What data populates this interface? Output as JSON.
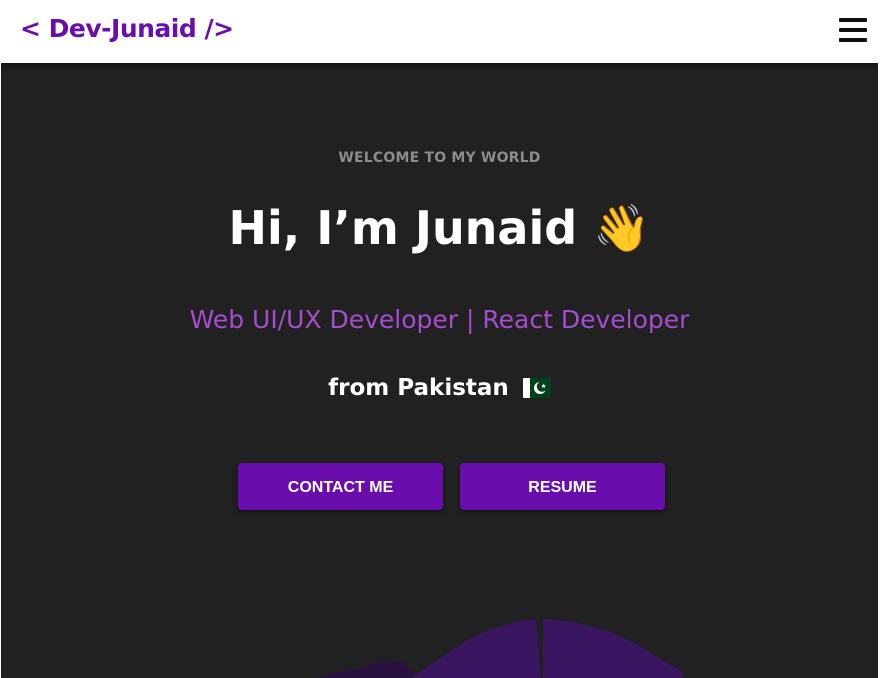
{
  "navbar": {
    "logo_text": "< Dev-Junaid />",
    "menu_icon": "hamburger-menu-icon"
  },
  "hero": {
    "welcome": "WELCOME TO MY WORLD",
    "greeting": "Hi, I’m Junaid",
    "greeting_emoji": "👋",
    "role": "Web UI/UX Developer | React Developer",
    "origin": "from Pakistan",
    "origin_flag_icon": "pakistan-flag-icon",
    "buttons": {
      "contact_label": "CONTACT ME",
      "resume_label": "RESUME"
    }
  },
  "colors": {
    "accent": "#6a0dad",
    "role_text": "#a64dcf",
    "background": "#212121",
    "navbar": "#ffffff",
    "welcome_text": "#8c8c8c"
  }
}
